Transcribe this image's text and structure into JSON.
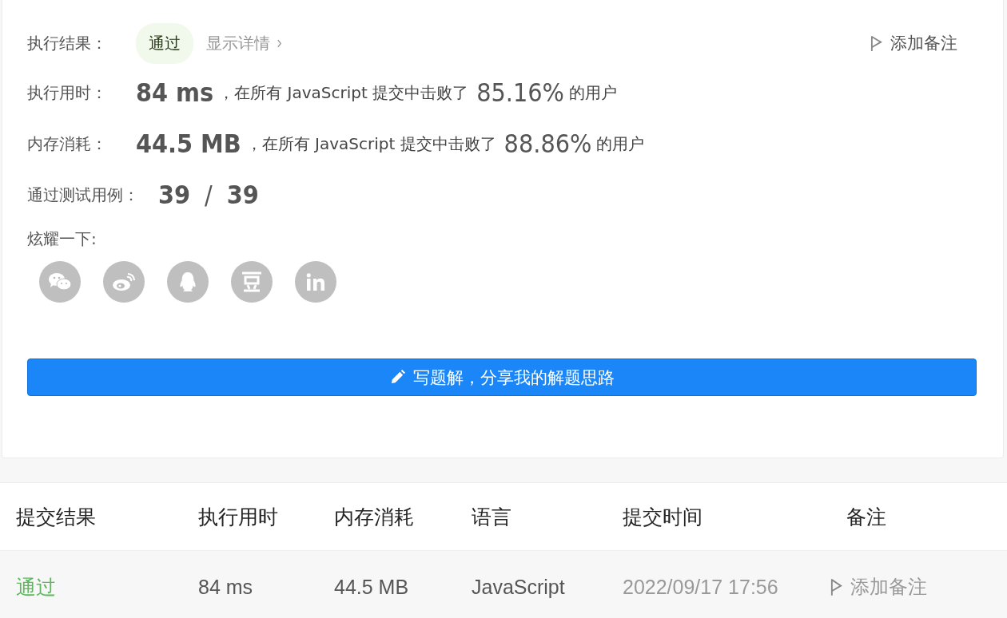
{
  "result": {
    "label": "执行结果：",
    "status": "通过",
    "details_link": "显示详情",
    "add_note": "添加备注"
  },
  "stats": [
    {
      "label": "执行用时：",
      "value": "84 ms",
      "sentence": "，在所有 JavaScript 提交中击败了",
      "percent": "85.16%",
      "suffix": "的用户"
    },
    {
      "label": "内存消耗：",
      "value": "44.5 MB",
      "sentence": "，在所有 JavaScript 提交中击败了",
      "percent": "88.86%",
      "suffix": "的用户"
    }
  ],
  "test_cases": {
    "label": "通过测试用例：",
    "passed": "39",
    "separator": "/",
    "total": "39"
  },
  "share": {
    "label": "炫耀一下:",
    "icons": [
      {
        "kind": "wechat"
      },
      {
        "kind": "weibo"
      },
      {
        "kind": "qq"
      },
      {
        "kind": "douban"
      },
      {
        "kind": "linkedin"
      }
    ]
  },
  "write_button": "写题解，分享我的解题思路",
  "table": {
    "columns": [
      "提交结果",
      "执行用时",
      "内存消耗",
      "语言",
      "提交时间",
      "备注"
    ],
    "rows": [
      {
        "status": "通过",
        "accepted": true,
        "time": "84 ms",
        "memory": "44.5 MB",
        "language": "JavaScript",
        "submitted": "2022/09/17 17:56",
        "note": "添加备注"
      }
    ]
  }
}
